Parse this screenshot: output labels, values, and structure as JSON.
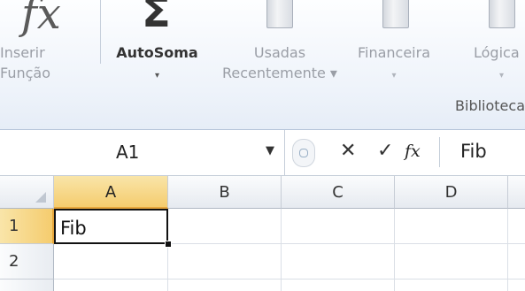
{
  "ribbon": {
    "buttons": [
      {
        "id": "inserir-funcao",
        "label_line1": "Inserir",
        "label_line2": "Função",
        "icon": "fx-icon",
        "enabled": true
      },
      {
        "id": "autosoma",
        "label_line1": "AutoSoma",
        "label_line2": "▾",
        "icon": "sigma-icon",
        "enabled": true
      },
      {
        "id": "usadas",
        "label_line1": "Usadas",
        "label_line2": "Recentemente ▾",
        "icon": "book-star-icon",
        "enabled": false
      },
      {
        "id": "financeira",
        "label_line1": "Financeira",
        "label_line2": "▾",
        "icon": "book-money-icon",
        "enabled": false
      },
      {
        "id": "logica",
        "label_line1": "Lógica",
        "label_line2": "▾",
        "icon": "book-question-icon",
        "enabled": false
      }
    ],
    "group_label": "Biblioteca"
  },
  "formula_bar": {
    "name_box": "A1",
    "cancel_symbol": "✕",
    "enter_symbol": "✓",
    "fx_symbol": "fx",
    "formula": "Fib"
  },
  "grid": {
    "columns": [
      "A",
      "B",
      "C",
      "D"
    ],
    "rows": [
      "1",
      "2"
    ],
    "cells": {
      "A1": "Fib"
    },
    "selected_cell": "A1"
  },
  "colors": {
    "selection_header": "#f5cc6e",
    "selection_border": "#e7a63c"
  }
}
